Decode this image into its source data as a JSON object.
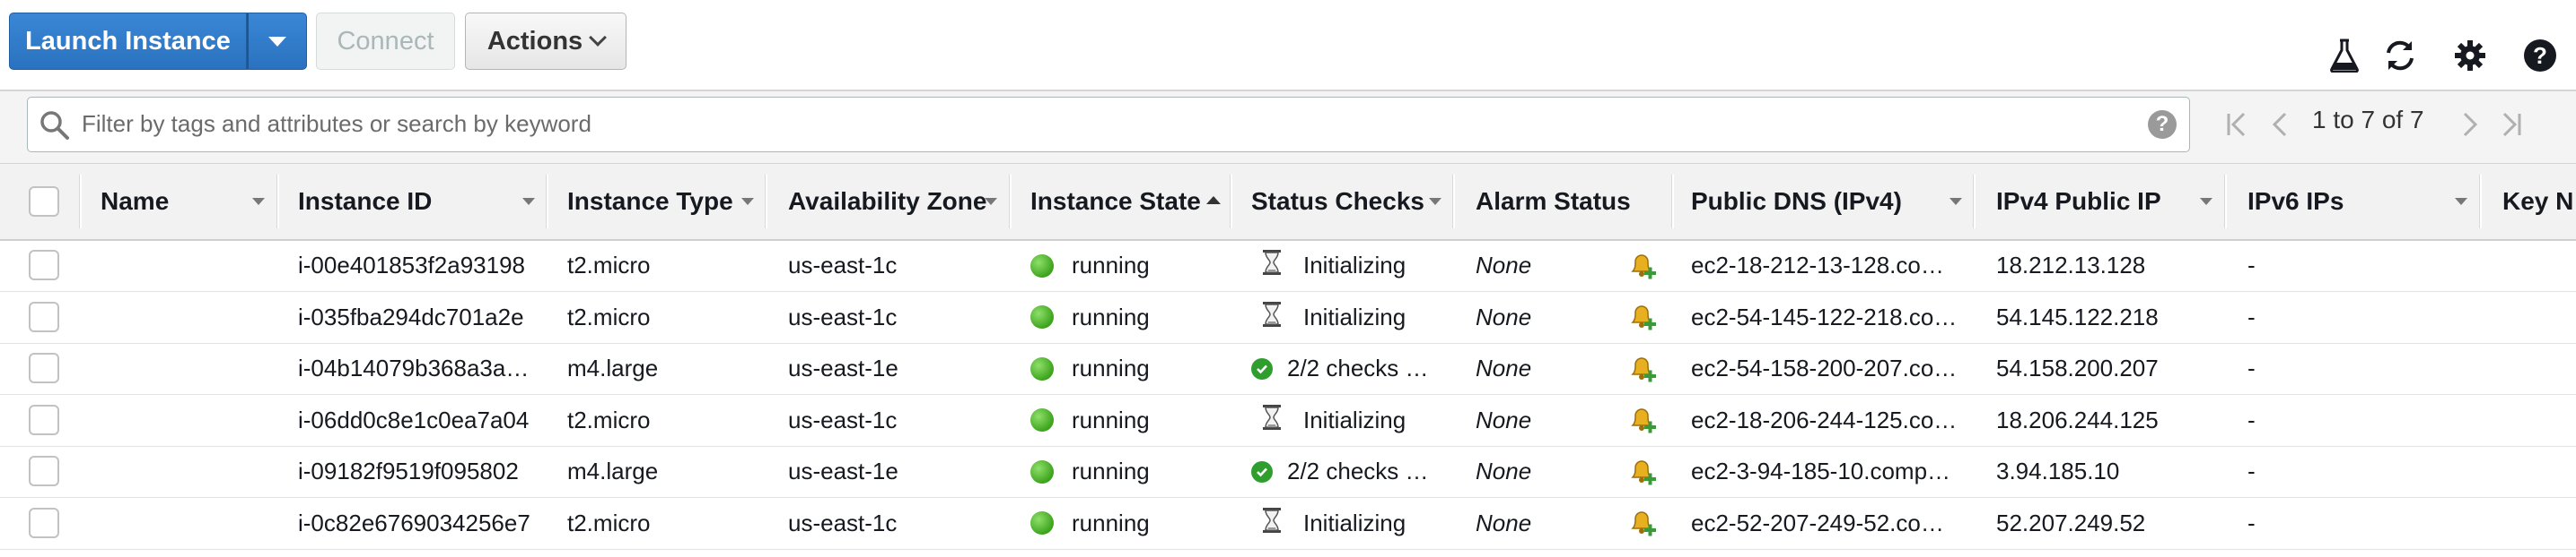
{
  "toolbar": {
    "launch_label": "Launch Instance",
    "connect_label": "Connect",
    "actions_label": "Actions"
  },
  "search": {
    "placeholder": "Filter by tags and attributes or search by keyword",
    "help": "?"
  },
  "pager": {
    "text": "1 to 7 of 7"
  },
  "columns": {
    "name": "Name",
    "instance_id": "Instance ID",
    "instance_type": "Instance Type",
    "availability_zone": "Availability Zone",
    "instance_state": "Instance State",
    "status_checks": "Status Checks",
    "alarm_status": "Alarm Status",
    "public_dns": "Public DNS (IPv4)",
    "ipv4_public_ip": "IPv4 Public IP",
    "ipv6_ips": "IPv6 IPs",
    "key_name": "Key N"
  },
  "rows": [
    {
      "id": "i-00e401853f2a93198",
      "type": "t2.micro",
      "zone": "us-east-1c",
      "state": "running",
      "status": "Initializing",
      "status_icon": "hourglass-icon",
      "alarm": "None",
      "dns": "ec2-18-212-13-128.co…",
      "ip": "18.212.13.128",
      "ipv6": "-"
    },
    {
      "id": "i-035fba294dc701a2e",
      "type": "t2.micro",
      "zone": "us-east-1c",
      "state": "running",
      "status": "Initializing",
      "status_icon": "hourglass-icon",
      "alarm": "None",
      "dns": "ec2-54-145-122-218.co…",
      "ip": "54.145.122.218",
      "ipv6": "-"
    },
    {
      "id": "i-04b14079b368a3a…",
      "type": "m4.large",
      "zone": "us-east-1e",
      "state": "running",
      "status": "2/2 checks …",
      "status_icon": "check-icon",
      "alarm": "None",
      "dns": "ec2-54-158-200-207.co…",
      "ip": "54.158.200.207",
      "ipv6": "-"
    },
    {
      "id": "i-06dd0c8e1c0ea7a04",
      "type": "t2.micro",
      "zone": "us-east-1c",
      "state": "running",
      "status": "Initializing",
      "status_icon": "hourglass-icon",
      "alarm": "None",
      "dns": "ec2-18-206-244-125.co…",
      "ip": "18.206.244.125",
      "ipv6": "-"
    },
    {
      "id": "i-09182f9519f095802",
      "type": "m4.large",
      "zone": "us-east-1e",
      "state": "running",
      "status": "2/2 checks …",
      "status_icon": "check-icon",
      "alarm": "None",
      "dns": "ec2-3-94-185-10.comp…",
      "ip": "3.94.185.10",
      "ipv6": "-"
    },
    {
      "id": "i-0c82e6769034256e7",
      "type": "t2.micro",
      "zone": "us-east-1c",
      "state": "running",
      "status": "Initializing",
      "status_icon": "hourglass-icon",
      "alarm": "None",
      "dns": "ec2-52-207-249-52.co…",
      "ip": "52.207.249.52",
      "ipv6": "-"
    }
  ],
  "colors": {
    "primary_button": "#2a72bf",
    "running_green": "#3da31d",
    "check_green": "#2f9e2f"
  },
  "icons": [
    "search-icon",
    "flask-icon",
    "refresh-icon",
    "gear-icon",
    "help-icon",
    "first-page-icon",
    "prev-page-icon",
    "next-page-icon",
    "last-page-icon",
    "hourglass-icon",
    "check-icon",
    "add-alarm-bell-icon"
  ]
}
